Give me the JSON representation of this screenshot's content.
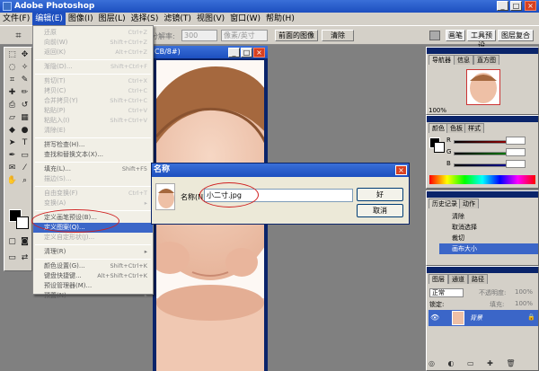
{
  "app": {
    "title": "Adobe Photoshop"
  },
  "menubar": [
    "文件(F)",
    "编辑(E)",
    "图像(I)",
    "图层(L)",
    "选择(S)",
    "滤镜(T)",
    "视图(V)",
    "窗口(W)",
    "帮助(H)"
  ],
  "options": {
    "feather_label": "分解率:",
    "feather_value": "300",
    "unit_value": "像素/英寸",
    "front_image_btn": "前面的图像",
    "clear_btn": "清除",
    "tabs": [
      "画笔",
      "工具预设",
      "图层复合"
    ]
  },
  "document": {
    "title": "CB/8#)"
  },
  "edit_menu": {
    "items": [
      {
        "label": "还原",
        "shortcut": "Ctrl+Z",
        "state": "dis"
      },
      {
        "label": "向前(W)",
        "shortcut": "Shift+Ctrl+Z",
        "state": "dis"
      },
      {
        "label": "返回(K)",
        "shortcut": "Alt+Ctrl+Z",
        "state": "dis"
      },
      {
        "sep": true
      },
      {
        "label": "渐隐(D)...",
        "shortcut": "Shift+Ctrl+F",
        "state": "dis"
      },
      {
        "sep": true
      },
      {
        "label": "剪切(T)",
        "shortcut": "Ctrl+X",
        "state": "dis"
      },
      {
        "label": "拷贝(C)",
        "shortcut": "Ctrl+C",
        "state": "dis"
      },
      {
        "label": "合并拷贝(Y)",
        "shortcut": "Shift+Ctrl+C",
        "state": "dis"
      },
      {
        "label": "粘贴(P)",
        "shortcut": "Ctrl+V",
        "state": "dis"
      },
      {
        "label": "粘贴入(I)",
        "shortcut": "Shift+Ctrl+V",
        "state": "dis"
      },
      {
        "label": "清除(E)",
        "shortcut": "",
        "state": "dis"
      },
      {
        "sep": true
      },
      {
        "label": "拼写检查(H)...",
        "shortcut": "",
        "state": ""
      },
      {
        "label": "查找和替换文本(X)...",
        "shortcut": "",
        "state": ""
      },
      {
        "sep": true
      },
      {
        "label": "填充(L)...",
        "shortcut": "Shift+F5",
        "state": ""
      },
      {
        "label": "描边(S)...",
        "shortcut": "",
        "state": "dis"
      },
      {
        "sep": true
      },
      {
        "label": "自由变换(F)",
        "shortcut": "Ctrl+T",
        "state": "dis"
      },
      {
        "label": "变换(A)",
        "shortcut": "▸",
        "state": "dis"
      },
      {
        "sep": true
      },
      {
        "label": "定义画笔预设(B)...",
        "shortcut": "",
        "state": ""
      },
      {
        "label": "定义图案(Q)...",
        "shortcut": "",
        "state": "hl"
      },
      {
        "label": "定义自定形状(J)...",
        "shortcut": "",
        "state": "dis"
      },
      {
        "sep": true
      },
      {
        "label": "清理(R)",
        "shortcut": "▸",
        "state": ""
      },
      {
        "sep": true
      },
      {
        "label": "颜色设置(G)...",
        "shortcut": "Shift+Ctrl+K",
        "state": ""
      },
      {
        "label": "键盘快捷键...",
        "shortcut": "Alt+Shift+Ctrl+K",
        "state": ""
      },
      {
        "label": "预设管理器(M)...",
        "shortcut": "",
        "state": ""
      },
      {
        "label": "预置(N)",
        "shortcut": "▸",
        "state": ""
      }
    ]
  },
  "dialog": {
    "title": "名称",
    "name_label": "名称(N):",
    "name_value": "小二寸.jpg",
    "ok": "好",
    "cancel": "取消"
  },
  "navigator": {
    "tabs": [
      "导航器",
      "信息",
      "直方图"
    ],
    "zoom": "100%"
  },
  "color_panel": {
    "tabs": [
      "颜色",
      "色板",
      "样式"
    ],
    "channels": [
      {
        "label": "R",
        "color": "#c00000"
      },
      {
        "label": "G",
        "color": "#00a000"
      },
      {
        "label": "B",
        "color": "#0000c0"
      }
    ]
  },
  "history": {
    "tabs": [
      "历史记录",
      "动作"
    ],
    "items": [
      "清除",
      "取消选择",
      "裁切",
      "画布大小"
    ]
  },
  "layers": {
    "tabs": [
      "图层",
      "通道",
      "路径"
    ],
    "blend": "正常",
    "opacity_label": "不透明度:",
    "opacity": "100%",
    "lock_label": "锁定:",
    "fill_label": "填充:",
    "fill": "100%",
    "layer_name": "背景"
  },
  "colors": {
    "accent": "#1e4fbf",
    "highlight": "#3b66c8",
    "annotation": "#d02020"
  }
}
